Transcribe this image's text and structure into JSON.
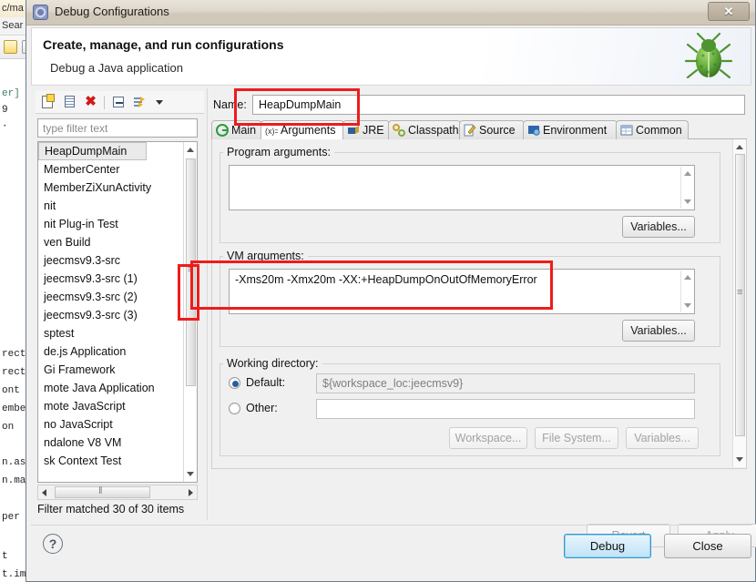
{
  "background_ide": {
    "tab_label": "c/ma",
    "menu_label": "Sear",
    "code_lines": [
      "er]",
      "9",
      "·",
      "rectiv",
      "rectiv",
      "ont",
      "embe",
      "on",
      "n.ass",
      "n.mai",
      "per",
      "t",
      "t.imp"
    ]
  },
  "window": {
    "title": "Debug Configurations",
    "title_icon": "debug-config-icon",
    "close_label": "✕"
  },
  "banner": {
    "title": "Create, manage, and run configurations",
    "subtitle": "Debug a Java application",
    "icon": "bug-icon"
  },
  "left_panel": {
    "toolbar": [
      {
        "name": "new-launch-configuration-icon",
        "label": "New launch configuration"
      },
      {
        "name": "duplicate-icon",
        "label": "Duplicate"
      },
      {
        "name": "delete-icon",
        "label": "Delete"
      },
      {
        "name": "collapse-all-icon",
        "label": "Collapse All"
      },
      {
        "name": "filter-icon",
        "label": "Filter launch configurations"
      },
      {
        "name": "chevron-down-icon",
        "label": "View Menu"
      }
    ],
    "filter": {
      "placeholder": "type filter text",
      "value": ""
    },
    "tree_items": [
      {
        "label": "HeapDumpMain",
        "selected": true
      },
      {
        "label": "MemberCenter",
        "selected": false
      },
      {
        "label": "MemberZiXunActivity",
        "selected": false
      },
      {
        "label": "nit",
        "selected": false
      },
      {
        "label": "nit Plug-in Test",
        "selected": false
      },
      {
        "label": "ven Build",
        "selected": false
      },
      {
        "label": "jeecmsv9.3-src",
        "selected": false
      },
      {
        "label": "jeecmsv9.3-src (1)",
        "selected": false
      },
      {
        "label": "jeecmsv9.3-src (2)",
        "selected": false
      },
      {
        "label": "jeecmsv9.3-src (3)",
        "selected": false
      },
      {
        "label": "sptest",
        "selected": false
      },
      {
        "label": "de.js Application",
        "selected": false
      },
      {
        "label": "Gi Framework",
        "selected": false
      },
      {
        "label": "mote Java Application",
        "selected": false
      },
      {
        "label": "mote JavaScript",
        "selected": false
      },
      {
        "label": "no JavaScript",
        "selected": false
      },
      {
        "label": "ndalone V8 VM",
        "selected": false
      },
      {
        "label": "sk Context Test",
        "selected": false
      }
    ],
    "status": "Filter matched 30 of 30 items"
  },
  "right_panel": {
    "name_label": "Name:",
    "name_value": "HeapDumpMain",
    "tabs": [
      {
        "label": "Main",
        "icon": "main-tab-icon",
        "active": false
      },
      {
        "label": "Arguments",
        "icon": "arguments-tab-icon",
        "active": true
      },
      {
        "label": "JRE",
        "icon": "jre-tab-icon",
        "active": false
      },
      {
        "label": "Classpath",
        "icon": "classpath-tab-icon",
        "active": false
      },
      {
        "label": "Source",
        "icon": "source-tab-icon",
        "active": false
      },
      {
        "label": "Environment",
        "icon": "environment-tab-icon",
        "active": false
      },
      {
        "label": "Common",
        "icon": "common-tab-icon",
        "active": false
      }
    ],
    "program_arguments": {
      "group_label": "Program arguments:",
      "value": "",
      "variables_button": "Variables..."
    },
    "vm_arguments": {
      "group_label": "VM arguments:",
      "value": "-Xms20m -Xmx20m -XX:+HeapDumpOnOutOfMemoryError",
      "variables_button": "Variables..."
    },
    "working_directory": {
      "group_label": "Working directory:",
      "default_radio_label": "Default:",
      "default_radio_checked": true,
      "default_value": "${workspace_loc:jeecmsv9}",
      "other_radio_label": "Other:",
      "other_radio_checked": false,
      "other_value": "",
      "workspace_button": "Workspace...",
      "filesystem_button": "File System...",
      "variables_button": "Variables..."
    },
    "revert_button": "Revert",
    "apply_button": "Apply"
  },
  "footer": {
    "help_icon": "?",
    "debug_button": "Debug",
    "close_button": "Close"
  },
  "annotations": {
    "color": "#ee1c1c",
    "boxes": [
      {
        "name": "name-field-highlight"
      },
      {
        "name": "vm-arguments-highlight"
      },
      {
        "name": "tree-scrollbar-highlight"
      }
    ]
  }
}
